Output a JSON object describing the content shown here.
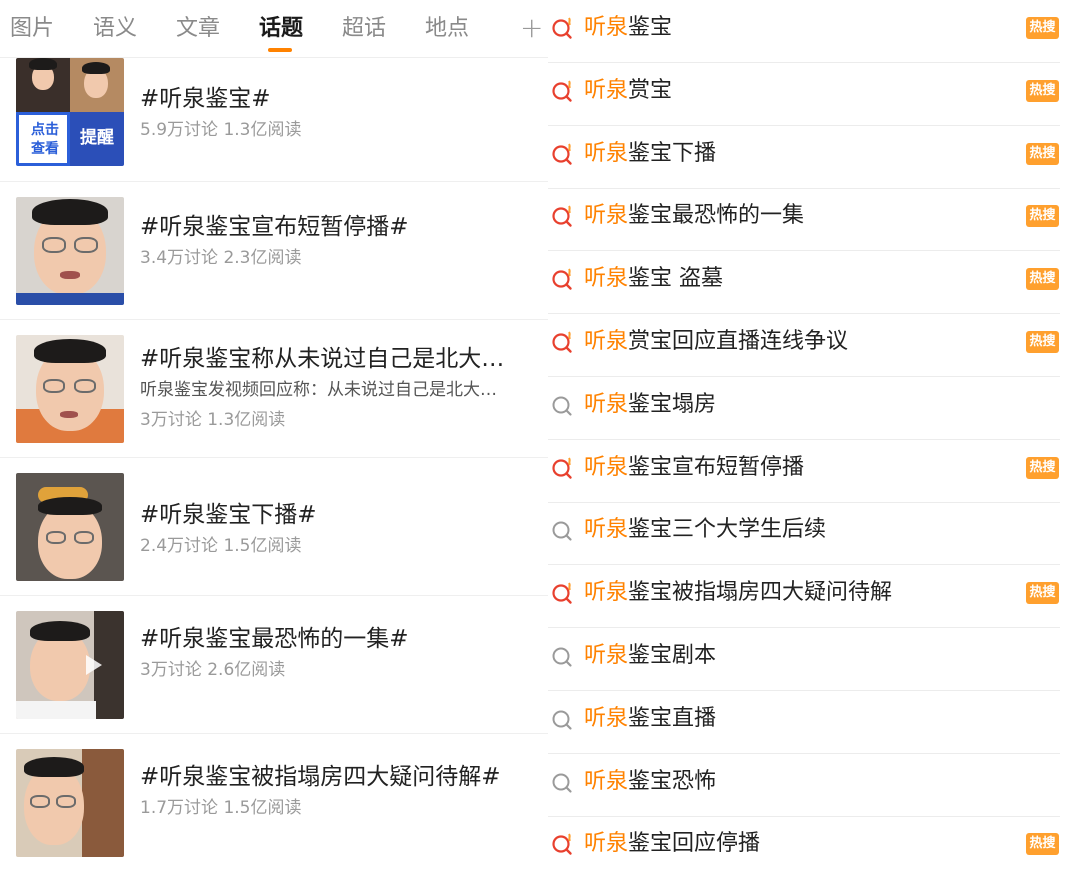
{
  "tabs": {
    "items": [
      {
        "label": "图片"
      },
      {
        "label": "语义"
      },
      {
        "label": "文章"
      },
      {
        "label": "话题"
      },
      {
        "label": "超话"
      },
      {
        "label": "地点"
      }
    ],
    "active_index": 3,
    "plus_icon": "plus-icon"
  },
  "topics": [
    {
      "title": "#听泉鉴宝#",
      "stats": "5.9万讨论 1.3亿阅读",
      "thumb_labels": [
        "点击",
        "查看",
        "提醒"
      ]
    },
    {
      "title": "#听泉鉴宝宣布短暂停播#",
      "stats": "3.4万讨论 2.3亿阅读"
    },
    {
      "title": "#听泉鉴宝称从未说过自己是北大…",
      "desc": "听泉鉴宝发视频回应称：从未说过自己是北大…",
      "stats": "3万讨论 1.3亿阅读"
    },
    {
      "title": "#听泉鉴宝下播#",
      "stats": "2.4万讨论 1.5亿阅读"
    },
    {
      "title": "#听泉鉴宝最恐怖的一集#",
      "stats": "3万讨论 2.6亿阅读"
    },
    {
      "title": "#听泉鉴宝被指塌房四大疑问待解#",
      "stats": "1.7万讨论 1.5亿阅读"
    }
  ],
  "suggestions": [
    {
      "highlight": "听泉",
      "rest": "鉴宝",
      "hot": true,
      "icon": "hot-search-icon"
    },
    {
      "highlight": "听泉",
      "rest": "赏宝",
      "hot": true,
      "icon": "hot-search-icon"
    },
    {
      "highlight": "听泉",
      "rest": "鉴宝下播",
      "hot": true,
      "icon": "hot-search-icon"
    },
    {
      "highlight": "听泉",
      "rest": "鉴宝最恐怖的一集",
      "hot": true,
      "icon": "hot-search-icon"
    },
    {
      "highlight": "听泉",
      "rest": "鉴宝 盗墓",
      "hot": true,
      "icon": "hot-search-icon"
    },
    {
      "highlight": "听泉",
      "rest": "赏宝回应直播连线争议",
      "hot": true,
      "icon": "hot-search-icon"
    },
    {
      "highlight": "听泉",
      "rest": "鉴宝塌房",
      "hot": false,
      "icon": "search-icon"
    },
    {
      "highlight": "听泉",
      "rest": "鉴宝宣布短暂停播",
      "hot": true,
      "icon": "hot-search-icon"
    },
    {
      "highlight": "听泉",
      "rest": "鉴宝三个大学生后续",
      "hot": false,
      "icon": "search-icon"
    },
    {
      "highlight": "听泉",
      "rest": "鉴宝被指塌房四大疑问待解",
      "hot": true,
      "icon": "hot-search-icon"
    },
    {
      "highlight": "听泉",
      "rest": "鉴宝剧本",
      "hot": false,
      "icon": "search-icon"
    },
    {
      "highlight": "听泉",
      "rest": "鉴宝直播",
      "hot": false,
      "icon": "search-icon"
    },
    {
      "highlight": "听泉",
      "rest": "鉴宝恐怖",
      "hot": false,
      "icon": "search-icon"
    },
    {
      "highlight": "听泉",
      "rest": "鉴宝回应停播",
      "hot": true,
      "icon": "hot-search-icon"
    }
  ],
  "hot_badge_label": "热搜",
  "colors": {
    "accent": "#ff8200",
    "badge": "#ffa02e",
    "hot_icon": "#e8402e"
  }
}
